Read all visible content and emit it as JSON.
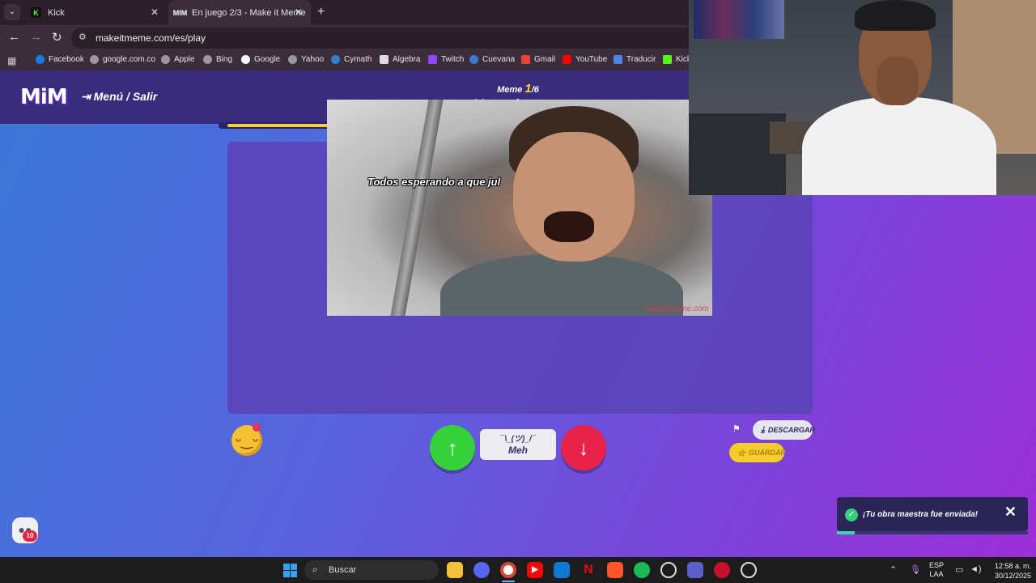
{
  "browser": {
    "tabs": [
      {
        "title": "Kick",
        "favicon": "K"
      },
      {
        "title": "En juego 2/3 - Make it Meme",
        "favicon": "MIM"
      }
    ],
    "url": "makeitmeme.com/es/play",
    "bookmarks": [
      "Facebook",
      "google.com.co",
      "Apple",
      "Bing",
      "Google",
      "Yahoo",
      "Cymath",
      "Algebra",
      "Twitch",
      "Cuevana",
      "Gmail",
      "YouTube",
      "Traducir",
      "Kick"
    ]
  },
  "game": {
    "logo": "MiM",
    "menu_link": "Menú / Salir",
    "round_prefix": "Meme",
    "round_current": "1",
    "round_total": "/6",
    "phase_title": "Vota el meme",
    "progress": 0.8,
    "meme": {
      "caption": "Todos esperando a que jul",
      "watermark": "makeitmeme.com"
    },
    "vote": {
      "meh_face": "¯\\_(ツ)_/¯",
      "meh_label": "Meh"
    },
    "actions": {
      "download": "DESCARGAR",
      "save": "GUARDAR"
    },
    "chat_badge": "10",
    "toast": "¡Tu obra maestra fue enviada!"
  },
  "taskbar": {
    "search_label": "Buscar",
    "lang_line1": "ESP",
    "lang_line2": "LAA",
    "time": "12:58 a. m.",
    "date": "30/12/2025"
  },
  "colors": {
    "accent_yellow": "#f7d21f",
    "vote_up": "#35d13a",
    "vote_down": "#e8224a",
    "header": "#3a2c7c"
  }
}
